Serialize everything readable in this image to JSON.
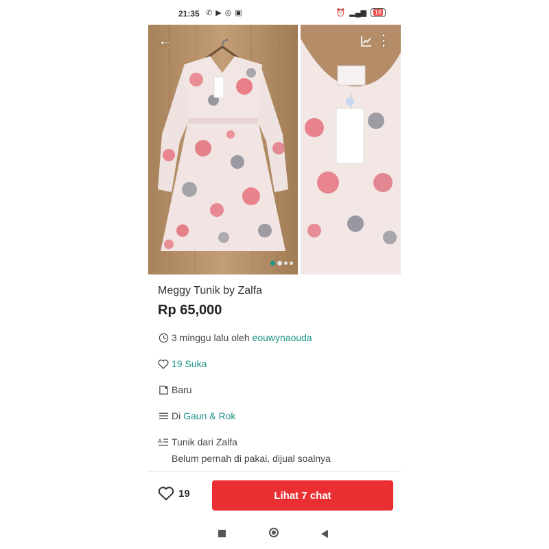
{
  "status_bar": {
    "time": "21:35",
    "left_icons": [
      "whatsapp-icon",
      "play-store-icon",
      "instagram-icon",
      "photo-icon"
    ],
    "right_icons": [
      "alarm-icon",
      "signal-icon"
    ],
    "battery": "18"
  },
  "gallery": {
    "photo_count": 4,
    "active_index": 0
  },
  "product": {
    "title": "Meggy Tunik by Zalfa",
    "price": "Rp 65,000",
    "posted_prefix": "3 minggu lalu oleh ",
    "seller": "eouwynaouda",
    "likes_label": "19 Suka",
    "condition": "Baru",
    "category_prefix": "Di ",
    "category": "Gaun & Rok",
    "description_line1": "Tunik dari Zalfa",
    "description_line2": "Belum pernah di pakai, dijual soalnya"
  },
  "bottom_bar": {
    "like_count": "19",
    "chat_button": "Lihat 7 chat"
  },
  "colors": {
    "accent": "#1a9286",
    "cta": "#ea2f33"
  }
}
